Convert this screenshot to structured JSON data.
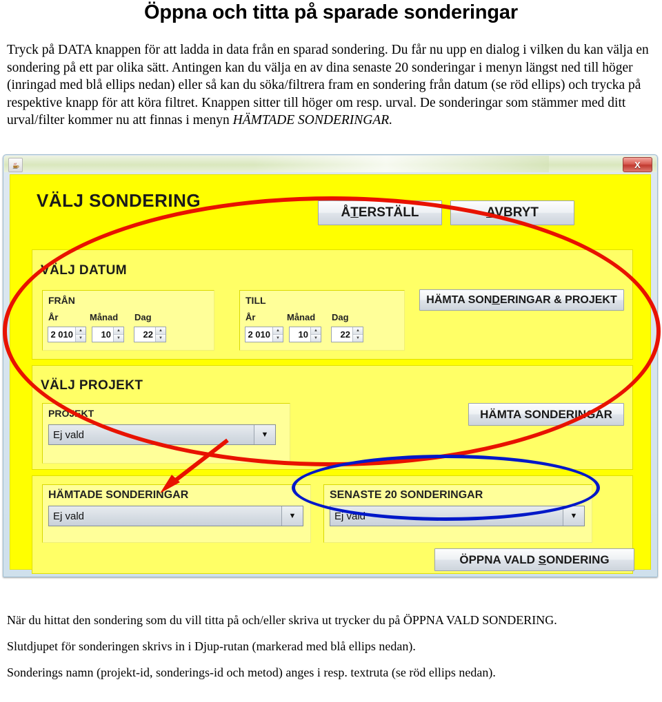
{
  "document": {
    "title": "Öppna och titta på sparade sonderingar",
    "intro_paragraph": "Tryck på DATA knappen för att ladda in data från en sparad sondering. Du får nu upp en dialog i vilken du kan välja en sondering på ett par olika sätt. Antingen kan du välja en av dina senaste 20 sonderingar i menyn längst ned till höger (inringad med blå ellips nedan) eller så kan du söka/filtrera fram en sondering från datum (se röd ellips) och trycka på respektive knapp för att köra filtret. Knappen sitter till höger om resp. urval. De sonderingar som stämmer med ditt urval/filter kommer nu att finnas i menyn ",
    "intro_italic": "HÄMTADE SONDERINGAR.",
    "outro": [
      "När du hittat den sondering som du vill titta på och/eller skriva ut trycker du på ÖPPNA VALD SONDERING.",
      "Slutdjupet för sonderingen skrivs in i Djup-rutan (markerad med blå ellips nedan).",
      "Sonderings namn (projekt-id, sonderings-id och metod) anges i resp. textruta (se röd ellips nedan)."
    ]
  },
  "dialog": {
    "titlebar": {
      "app_icon": "java-coffee-cup-icon",
      "close_label": "X"
    },
    "header": {
      "title": "VÄLJ SONDERING",
      "reset_button": {
        "prefix": "Å",
        "mnemonic": "T",
        "suffix": "ERSTÄLL"
      },
      "cancel_button": {
        "mnemonic": "A",
        "suffix": "VBRYT"
      }
    },
    "date_section": {
      "title": "VÄLJ DATUM",
      "from": {
        "label": "FRÅN",
        "fields": [
          {
            "label": "År",
            "value": "2 010"
          },
          {
            "label": "Månad",
            "value": "10"
          },
          {
            "label": "Dag",
            "value": "22"
          }
        ]
      },
      "to": {
        "label": "TILL",
        "fields": [
          {
            "label": "År",
            "value": "2 010"
          },
          {
            "label": "Månad",
            "value": "10"
          },
          {
            "label": "Dag",
            "value": "22"
          }
        ]
      },
      "fetch_button": {
        "prefix": "HÄMTA SON",
        "mnemonic": "D",
        "suffix": "ERINGAR & PROJEKT"
      }
    },
    "project_section": {
      "title": "VÄLJ PROJEKT",
      "group_label": "PROJEKT",
      "combo_value": "Ej vald",
      "fetch_button": {
        "label": "HÄMTA SONDERINGAR"
      }
    },
    "result_section": {
      "fetched": {
        "label": "HÄMTADE SONDERINGAR",
        "combo_value": "Ej vald"
      },
      "recent": {
        "label": "SENASTE 20 SONDERINGAR",
        "combo_value": "Ej vald"
      },
      "open_button": {
        "prefix": "ÖPPNA VALD ",
        "mnemonic": "S",
        "suffix": "ONDERING"
      }
    }
  },
  "annotations": {
    "red_ellipse_color": "#e81200",
    "blue_ellipse_color": "#0018c8",
    "red_arrow_color": "#e81200"
  },
  "colors": {
    "dialog_yellow": "#ffff00",
    "panel_yellow": "#ffff66",
    "subpanel_yellow": "#ffff99",
    "titlebar_green": "#d9e7bd",
    "close_red": "#c03a30"
  }
}
